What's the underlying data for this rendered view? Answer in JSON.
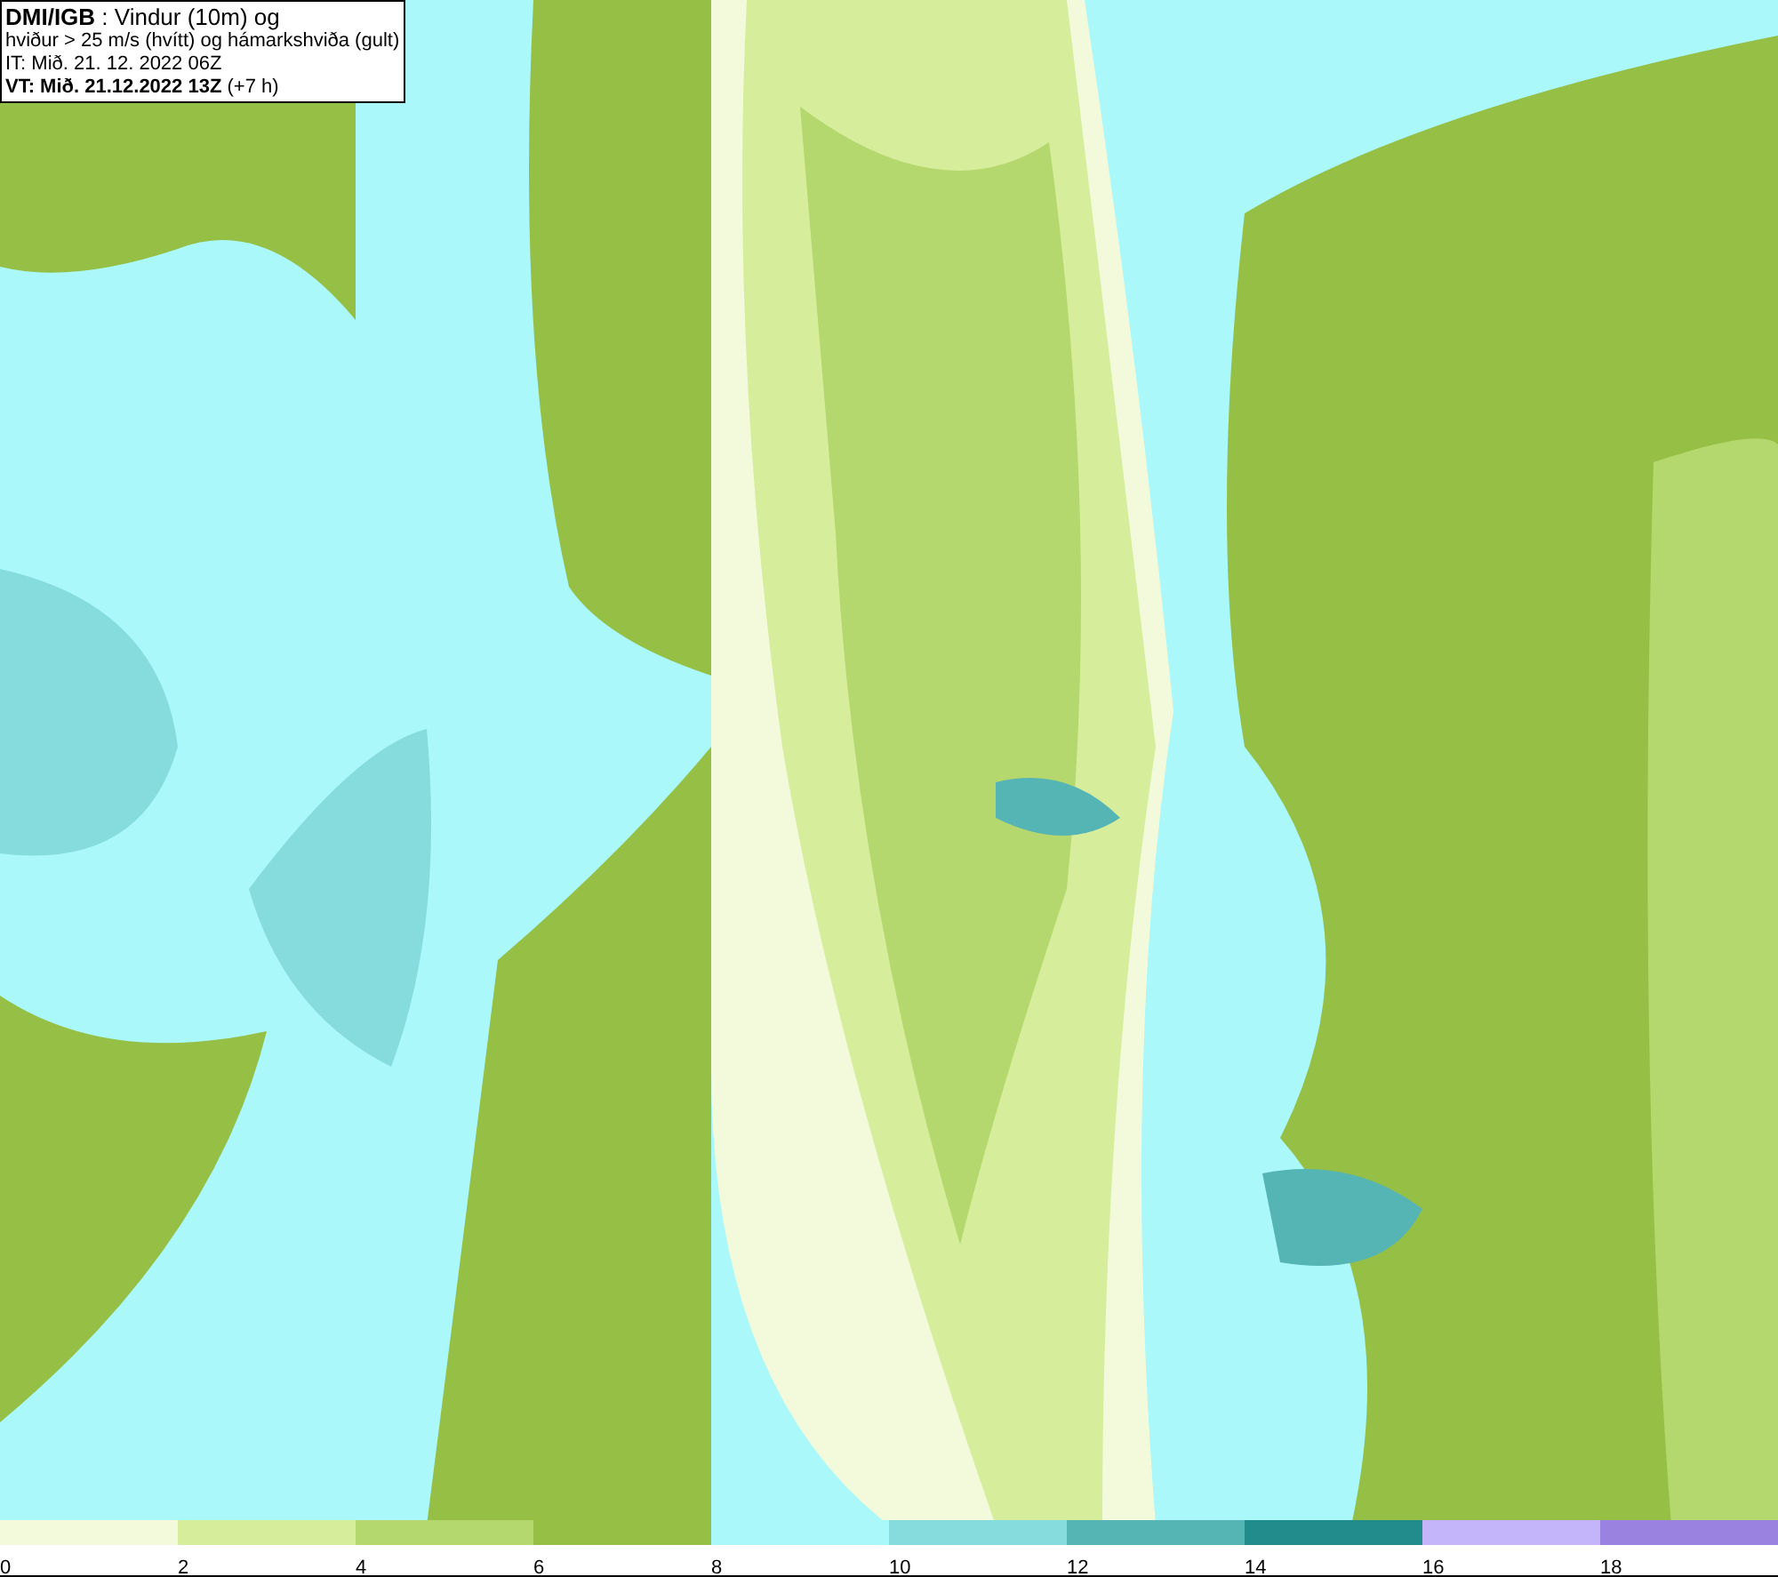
{
  "title_box": {
    "lines": [
      "**DMI/IGB** : Vindur (10m) og",
      "hviður > 25 m/s (hvítt) og hámarkshviða (gult)",
      "IT: Mið. 21. 12. 2022 06Z",
      "**VT: Mið. 21.12.2022 13Z** (+7 h)"
    ]
  },
  "legend": [
    {
      "label": "0",
      "color": "#f3fadc"
    },
    {
      "label": "2",
      "color": "#d6ee9c"
    },
    {
      "label": "4",
      "color": "#b5d86e"
    },
    {
      "label": "6",
      "color": "#96bf45"
    },
    {
      "label": "8",
      "color": "#aaf8fa"
    },
    {
      "label": "10",
      "color": "#86dcdc"
    },
    {
      "label": "12",
      "color": "#55b4b4"
    },
    {
      "label": "14",
      "color": "#228c8c"
    },
    {
      "label": "16",
      "color": "#c4b4fa"
    },
    {
      "label": "18",
      "color": "#9a82e0"
    }
  ]
}
